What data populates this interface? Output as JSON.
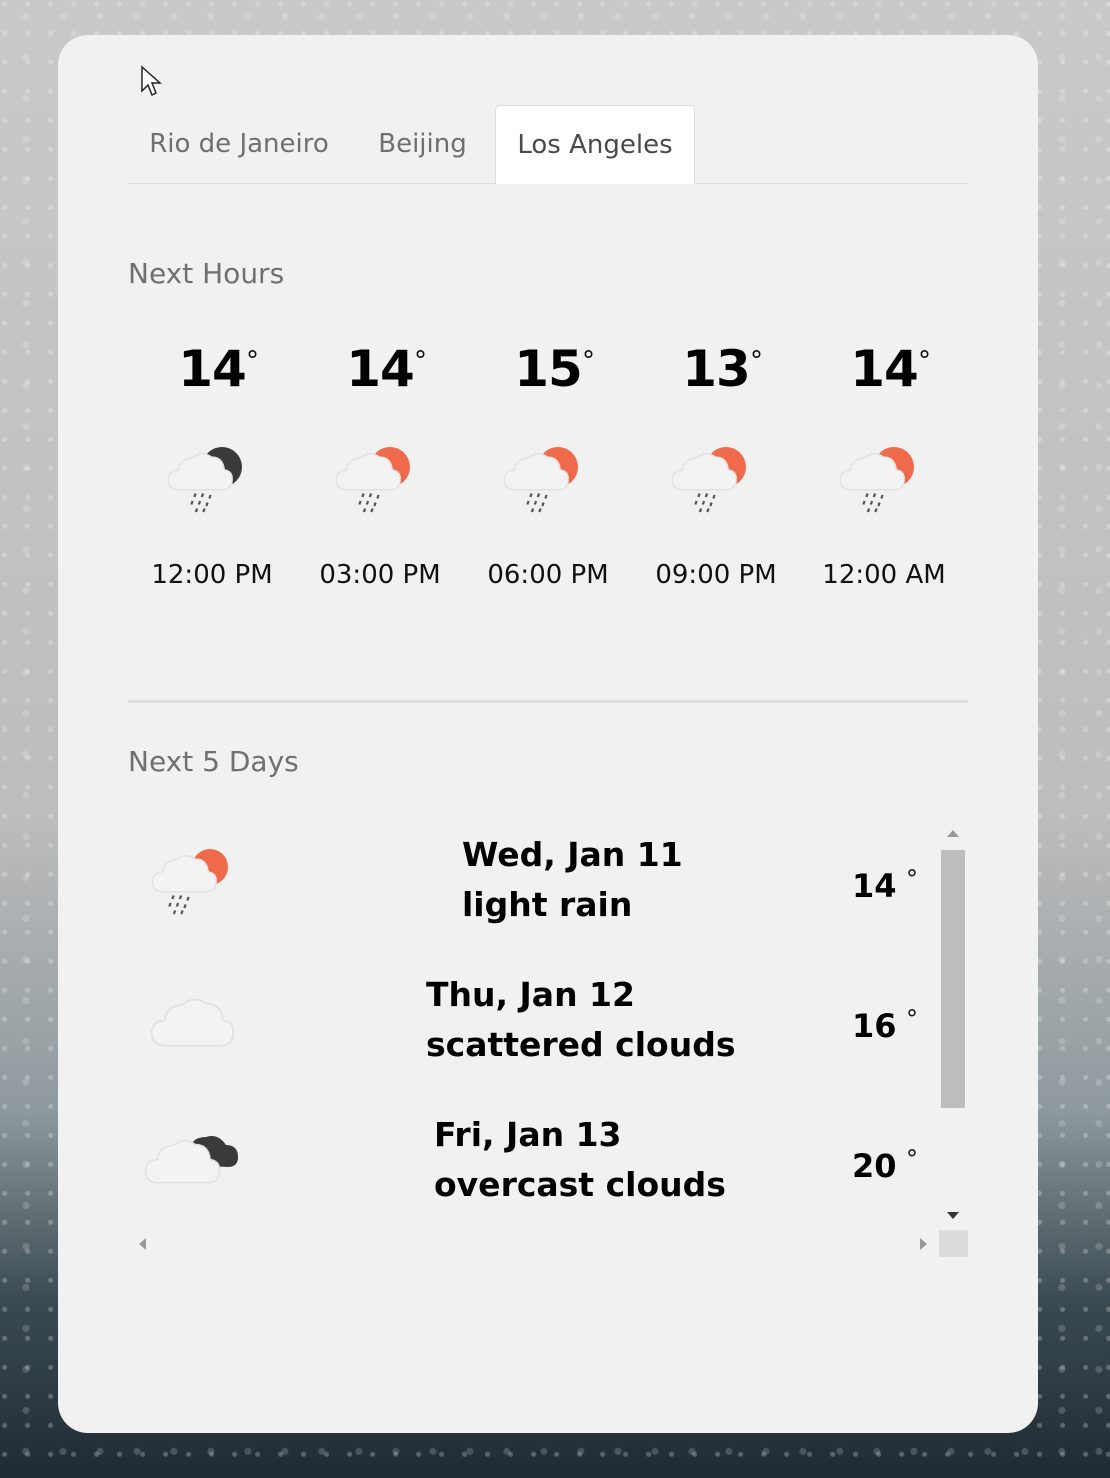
{
  "tabs": [
    {
      "label": "Rio de Janeiro",
      "selected": false
    },
    {
      "label": "Beijing",
      "selected": false
    },
    {
      "label": "Los Angeles",
      "selected": true
    }
  ],
  "next_hours": {
    "title": "Next Hours",
    "items": [
      {
        "temp": "14",
        "deg": "°",
        "time": "12:00 PM",
        "icon": "rain-cloud-night-icon"
      },
      {
        "temp": "14",
        "deg": "°",
        "time": "03:00 PM",
        "icon": "rain-cloud-sun-icon"
      },
      {
        "temp": "15",
        "deg": "°",
        "time": "06:00 PM",
        "icon": "rain-cloud-sun-icon"
      },
      {
        "temp": "13",
        "deg": "°",
        "time": "09:00 PM",
        "icon": "rain-cloud-sun-icon"
      },
      {
        "temp": "14",
        "deg": "°",
        "time": "12:00 AM",
        "icon": "rain-cloud-sun-icon"
      }
    ]
  },
  "next_days": {
    "title": "Next 5 Days",
    "items": [
      {
        "date": "Wed, Jan 11",
        "desc": "light rain",
        "temp": "14",
        "deg": "°",
        "icon": "rain-cloud-sun-icon"
      },
      {
        "date": "Thu, Jan 12",
        "desc": "scattered clouds",
        "temp": "16",
        "deg": "°",
        "icon": "scattered-clouds-icon"
      },
      {
        "date": "Fri, Jan 13",
        "desc": "overcast clouds",
        "temp": "20",
        "deg": "°",
        "icon": "overcast-clouds-icon"
      }
    ]
  },
  "colors": {
    "card_bg": "#f1f1f1",
    "sun_orange": "#ef6a4b",
    "moon_dark": "#3a3a3a",
    "cloud_light": "#f4f4f4"
  }
}
